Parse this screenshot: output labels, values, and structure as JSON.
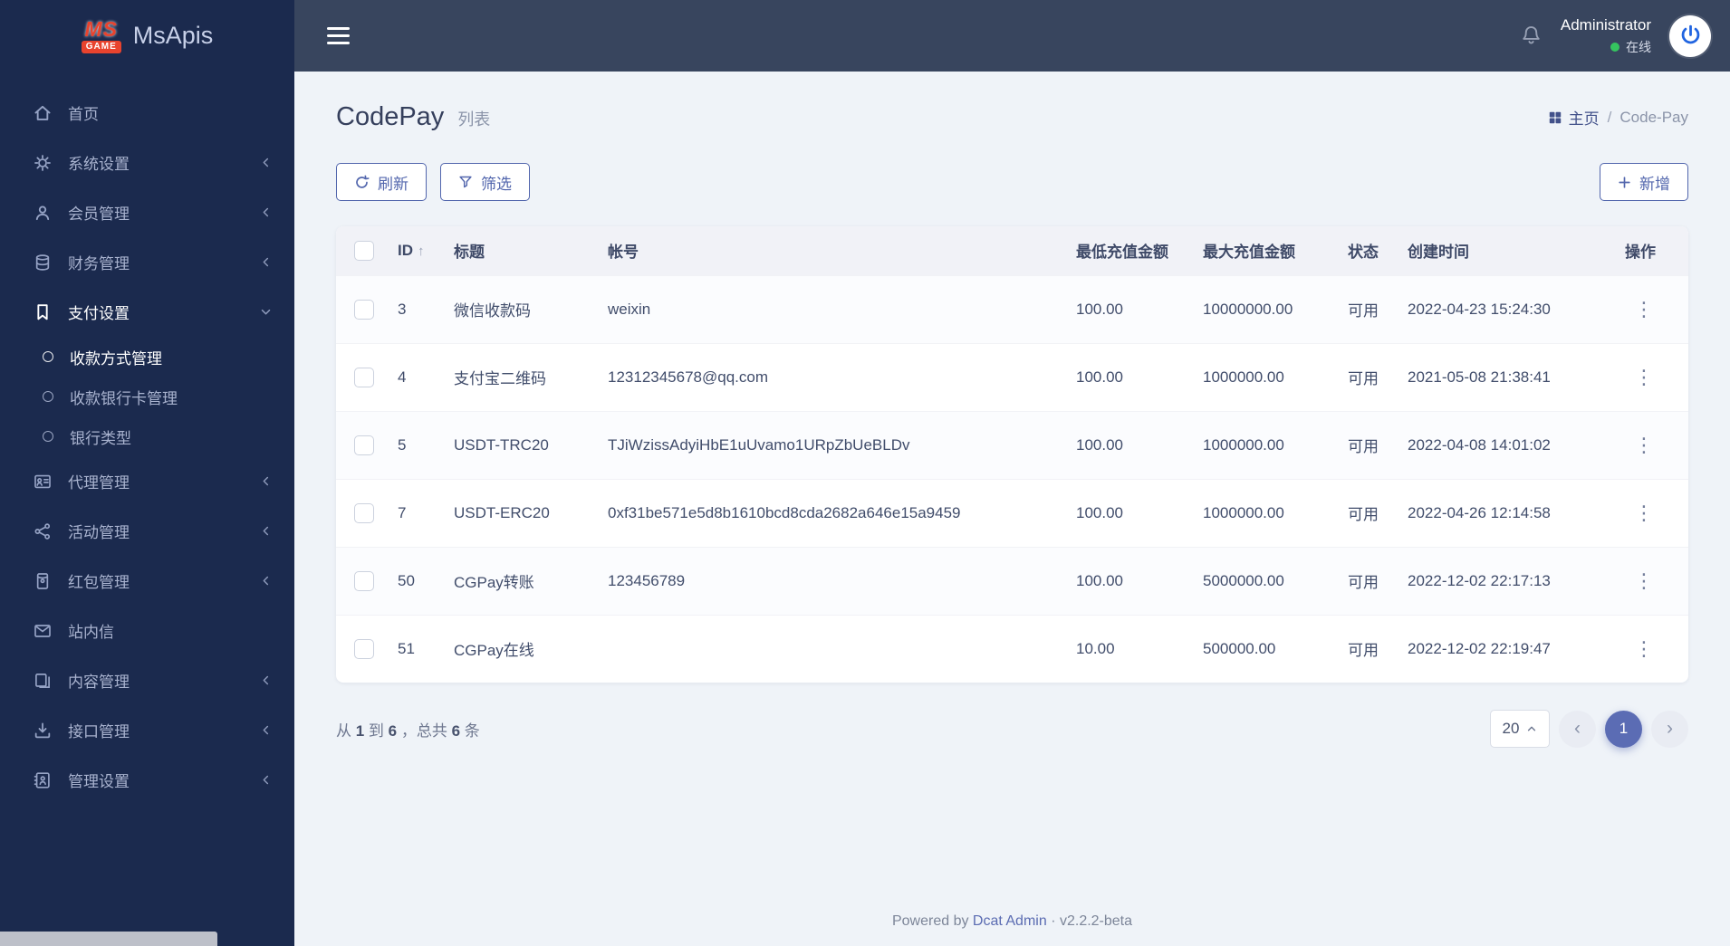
{
  "brand": {
    "logo_primary": "MS",
    "logo_secondary": "GAME",
    "app_name": "MsApis"
  },
  "topbar": {
    "user_name": "Administrator",
    "user_status": "在线"
  },
  "sidebar": {
    "items": [
      {
        "label": "首页"
      },
      {
        "label": "系统设置",
        "expandable": true
      },
      {
        "label": "会员管理",
        "expandable": true
      },
      {
        "label": "财务管理",
        "expandable": true
      },
      {
        "label": "支付设置",
        "expandable": true,
        "expanded": true,
        "children": [
          {
            "label": "收款方式管理",
            "active": true
          },
          {
            "label": "收款银行卡管理",
            "active": false
          },
          {
            "label": "银行类型",
            "active": false
          }
        ]
      },
      {
        "label": "代理管理",
        "expandable": true
      },
      {
        "label": "活动管理",
        "expandable": true
      },
      {
        "label": "红包管理",
        "expandable": true
      },
      {
        "label": "站内信"
      },
      {
        "label": "内容管理",
        "expandable": true
      },
      {
        "label": "接口管理",
        "expandable": true
      },
      {
        "label": "管理设置",
        "expandable": true
      }
    ]
  },
  "page": {
    "title": "CodePay",
    "subtitle": "列表"
  },
  "breadcrumb": {
    "home": "主页",
    "separator": "/",
    "current": "Code-Pay"
  },
  "toolbar": {
    "refresh_label": "刷新",
    "filter_label": "筛选",
    "add_label": "新增"
  },
  "table": {
    "headers": {
      "id": "ID",
      "title": "标题",
      "account": "帐号",
      "min_amount": "最低充值金额",
      "max_amount": "最大充值金额",
      "status": "状态",
      "created_at": "创建时间",
      "actions": "操作"
    },
    "rows": [
      {
        "id": "3",
        "title": "微信收款码",
        "account": "weixin",
        "min_amount": "100.00",
        "max_amount": "10000000.00",
        "status": "可用",
        "created_at": "2022-04-23 15:24:30"
      },
      {
        "id": "4",
        "title": "支付宝二维码",
        "account": "12312345678@qq.com",
        "min_amount": "100.00",
        "max_amount": "1000000.00",
        "status": "可用",
        "created_at": "2021-05-08 21:38:41"
      },
      {
        "id": "5",
        "title": "USDT-TRC20",
        "account": "TJiWzissAdyiHbE1uUvamo1URpZbUeBLDv",
        "min_amount": "100.00",
        "max_amount": "1000000.00",
        "status": "可用",
        "created_at": "2022-04-08 14:01:02"
      },
      {
        "id": "7",
        "title": "USDT-ERC20",
        "account": "0xf31be571e5d8b1610bcd8cda2682a646e15a9459",
        "min_amount": "100.00",
        "max_amount": "1000000.00",
        "status": "可用",
        "created_at": "2022-04-26 12:14:58"
      },
      {
        "id": "50",
        "title": "CGPay转账",
        "account": "123456789",
        "min_amount": "100.00",
        "max_amount": "5000000.00",
        "status": "可用",
        "created_at": "2022-12-02 22:17:13"
      },
      {
        "id": "51",
        "title": "CGPay在线",
        "account": "",
        "min_amount": "10.00",
        "max_amount": "500000.00",
        "status": "可用",
        "created_at": "2022-12-02 22:19:47"
      }
    ]
  },
  "pagination": {
    "summary_parts": [
      "从 ",
      "1",
      " 到 ",
      "6",
      " ，总共 ",
      "6",
      " 条"
    ],
    "page_size": "20",
    "current_page": "1"
  },
  "icons": {
    "sort_asc": "↑",
    "kebab": "⋮",
    "prev": "‹",
    "next": "›"
  },
  "footer": {
    "powered_by": "Powered by",
    "brand_link": "Dcat Admin",
    "separator": "·",
    "version": "v2.2.2-beta"
  },
  "colors": {
    "accent": "#586cb1",
    "sidebar_bg": "#1b2a4e",
    "topbar_bg": "#38455e",
    "status_online": "#35c45f",
    "logo_red": "#e8432e"
  }
}
